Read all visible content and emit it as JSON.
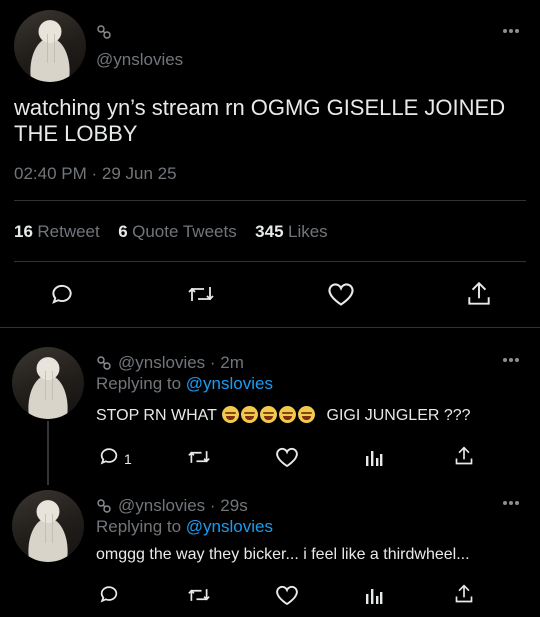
{
  "tweet": {
    "handle": "@ynslovies",
    "text_line1": "watching yn’s stream rn OGMG GISELLE JOINED",
    "text_line2": "THE LOBBY",
    "time": "02:40 PM",
    "dot": "·",
    "date": "29 Jun 25",
    "stats": {
      "retweets_count": "16",
      "retweets_label": "Retweet",
      "quotes_count": "6",
      "quotes_label": "Quote Tweets",
      "likes_count": "345",
      "likes_label": "Likes"
    }
  },
  "replies": [
    {
      "handle": "@ynslovies",
      "time": "· 2m",
      "replying_prefix": "Replying to",
      "replying_to": "@ynslovies",
      "text_before": "STOP RN WHAT",
      "text_after": "GIGI JUNGLER ???",
      "reply_count": "1"
    },
    {
      "handle": "@ynslovies",
      "time": "· 29s",
      "replying_prefix": "Replying to",
      "replying_to": "@ynslovies",
      "text": "omggg the way they bicker... i feel like a thirdwheel..."
    }
  ],
  "icons": {
    "more": "more-horizontal-icon",
    "link": "link-chain-icon",
    "reply": "reply-bubble-icon",
    "retweet": "retweet-icon",
    "like": "heart-icon",
    "analytics": "analytics-bars-icon",
    "share": "share-icon"
  },
  "colors": {
    "background": "#000000",
    "text": "#e7e9ea",
    "muted": "#71767b",
    "accent": "#1d9bf0",
    "divider": "#2f3336"
  }
}
